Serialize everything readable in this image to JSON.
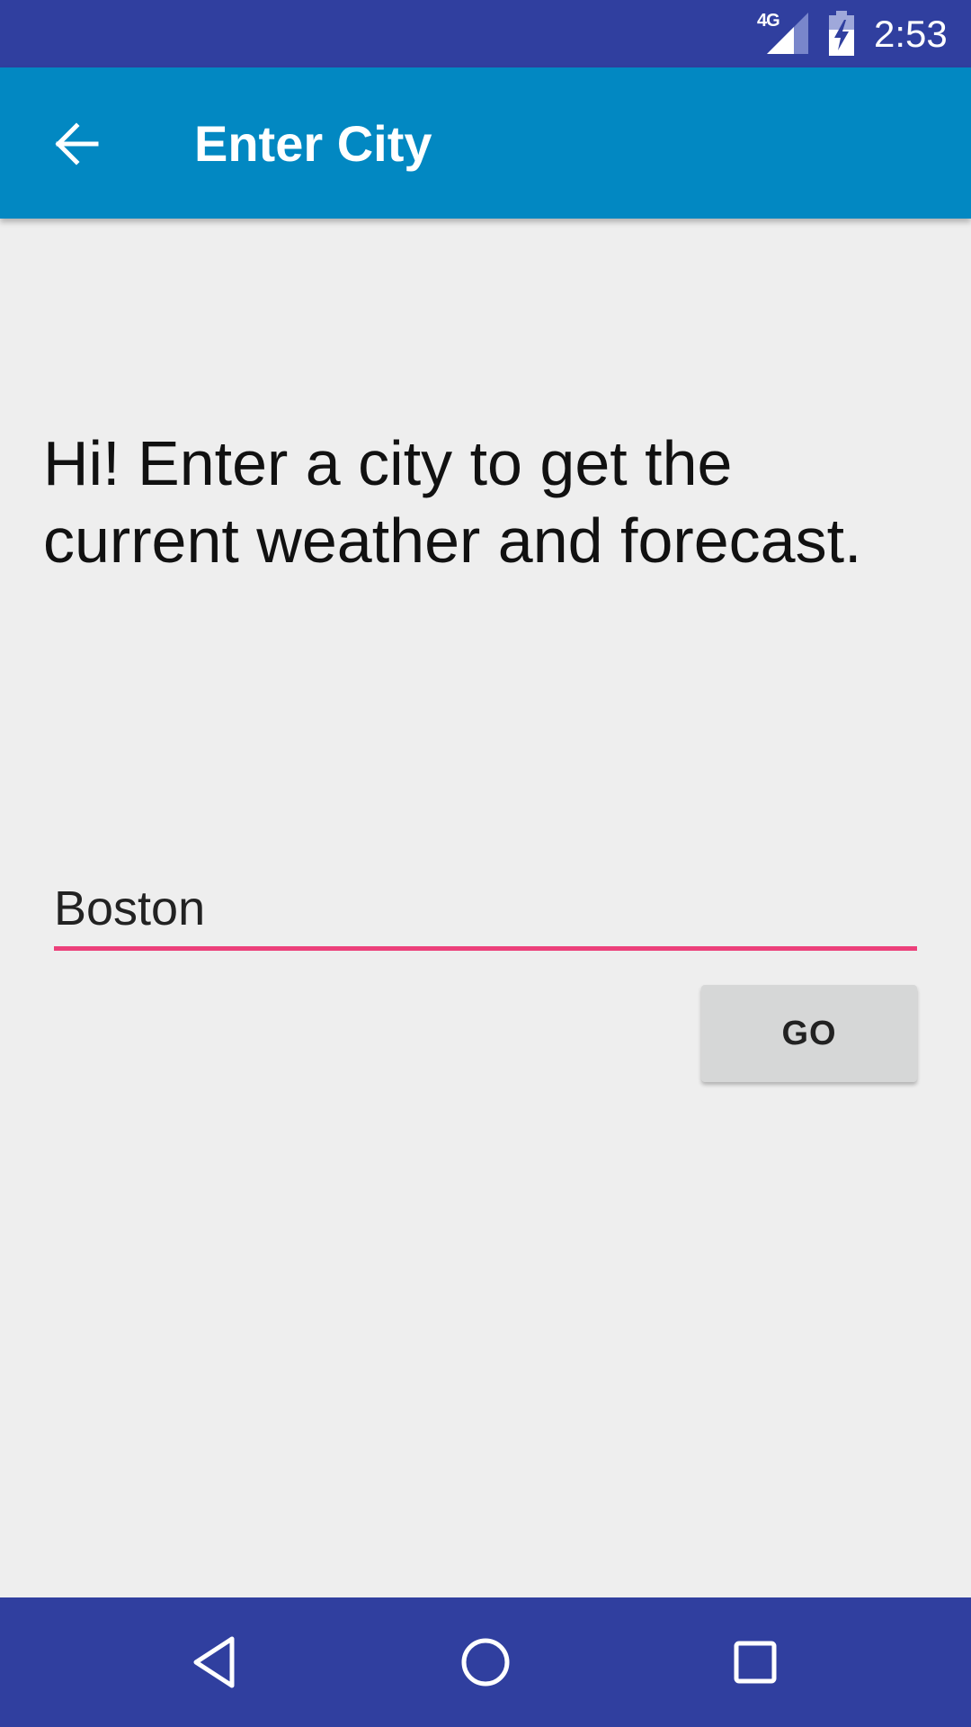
{
  "status_bar": {
    "network": "4G",
    "time": "2:53",
    "signal_icon": "cell-signal-icon",
    "battery_icon": "battery-charging-icon",
    "background": "#303f9f"
  },
  "app_bar": {
    "title": "Enter City",
    "back_icon": "arrow-back-icon",
    "background": "#0288c2"
  },
  "main": {
    "prompt": "Hi! Enter a city to get the current weather and forecast.",
    "city_input": {
      "value": "Boston",
      "underline_color": "#ec407a"
    },
    "go_button_label": "GO"
  },
  "nav_bar": {
    "back_icon": "nav-back-icon",
    "home_icon": "nav-home-icon",
    "recents_icon": "nav-recents-icon",
    "background": "#303f9f"
  }
}
